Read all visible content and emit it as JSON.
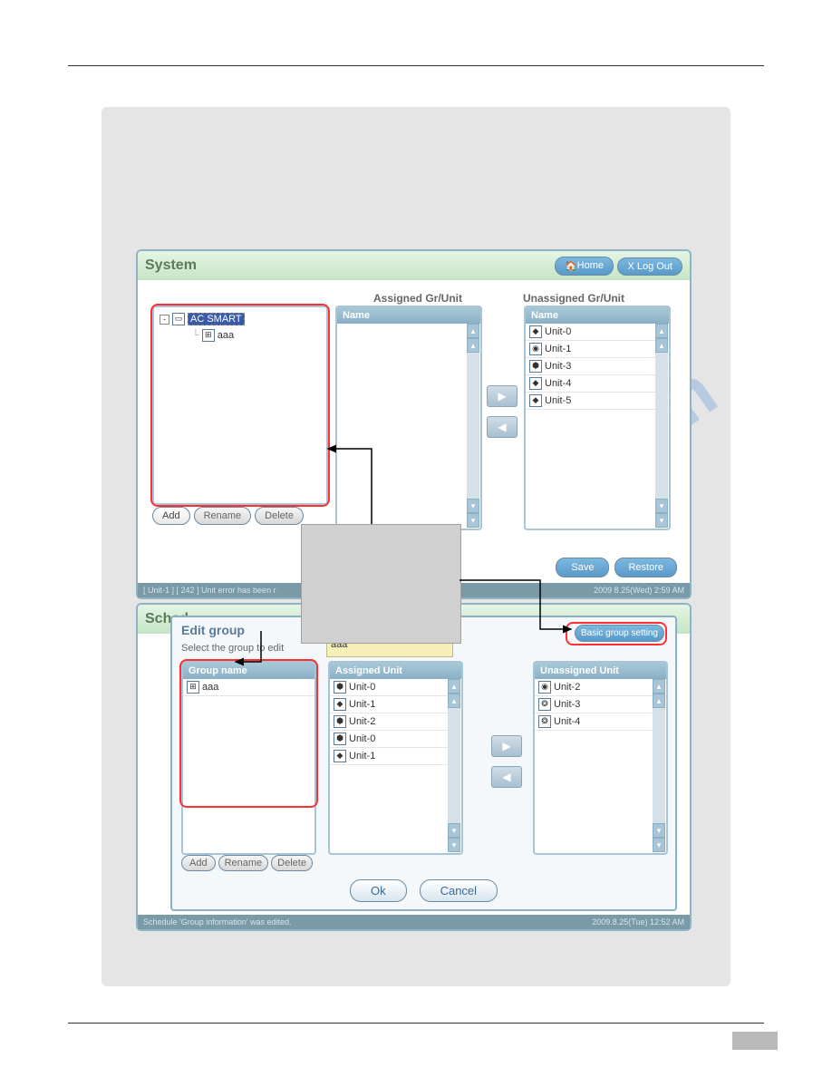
{
  "watermark": "manualshive.com",
  "system": {
    "title": "System",
    "home": "Home",
    "logout": "X Log Out",
    "assigned_label": "Assigned Gr/Unit",
    "unassigned_label": "Unassigned Gr/Unit",
    "col_name": "Name",
    "tree_root": "AC SMART",
    "tree_child": "aaa",
    "add": "Add",
    "rename": "Rename",
    "delete": "Delete",
    "save": "Save",
    "restore": "Restore",
    "unassigned_items": [
      "Unit-0",
      "Unit-1",
      "Unit-3",
      "Unit-4",
      "Unit-5"
    ],
    "status_left": "[ Unit-1 ] [ 242 ] Unit error has been r",
    "status_right": "2009 8.25(Wed)  2:59 AM"
  },
  "schedule": {
    "title_partial": "Sched",
    "edit_group": "Edit group",
    "select_text": "Select the group to edit",
    "group_value": "aaa",
    "group_name_hdr": "Group name",
    "group_items": [
      "aaa"
    ],
    "assigned_hdr": "Assigned Unit",
    "assigned_items": [
      "Unit-0",
      "Unit-1",
      "Unit-2",
      "Unit-0",
      "Unit-1"
    ],
    "unassigned_hdr": "Unassigned Unit",
    "unassigned_items": [
      "Unit-2",
      "Unit-3",
      "Unit-4"
    ],
    "basic_group": "Basic group setting",
    "add": "Add",
    "rename": "Rename",
    "delete": "Delete",
    "ok": "Ok",
    "cancel": "Cancel",
    "status_left": "Schedule    'Group information' was edited.",
    "status_right": "2009.8.25(Tue)   12:52 AM"
  }
}
